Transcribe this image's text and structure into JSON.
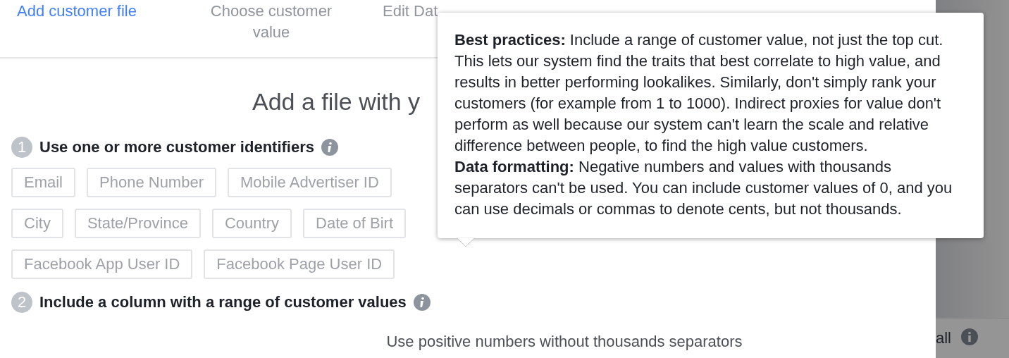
{
  "steps": [
    {
      "label": "Add customer file",
      "selected": true
    },
    {
      "label": "Choose customer value",
      "selected": false
    },
    {
      "label": "Edit Dat",
      "selected": false
    }
  ],
  "heading": "Add a file with y",
  "sections": [
    {
      "number": "1",
      "title": "Use one or more customer identifiers",
      "tag_rows": [
        [
          "Email",
          "Phone Number",
          "Mobile Advertiser ID"
        ],
        [
          "City",
          "State/Province",
          "Country",
          "Date of Birt"
        ],
        [
          "Facebook App User ID",
          "Facebook Page User ID"
        ]
      ]
    },
    {
      "number": "2",
      "title": "Include a column with a range of customer values",
      "note": "Use positive numbers without thousands separators"
    }
  ],
  "tooltip": {
    "paragraphs": [
      "**Best practices:** Include a range of customer value, not just the top cut. This lets our system find the traits that best correlate to high value, and results in better performing lookalikes. Similarly, don't simply rank your customers (for example from 1 to 1000). Indirect proxies for value don't perform as well because our system can't learn the scale and relative difference between people, to find the high value customers.",
      "**Data formatting:** Negative numbers and values with thousands separators can't be used. You can include customer values of 0, and you can use decimals or commas to denote cents, but not thousands."
    ]
  },
  "side_panel": {
    "label": "all"
  }
}
